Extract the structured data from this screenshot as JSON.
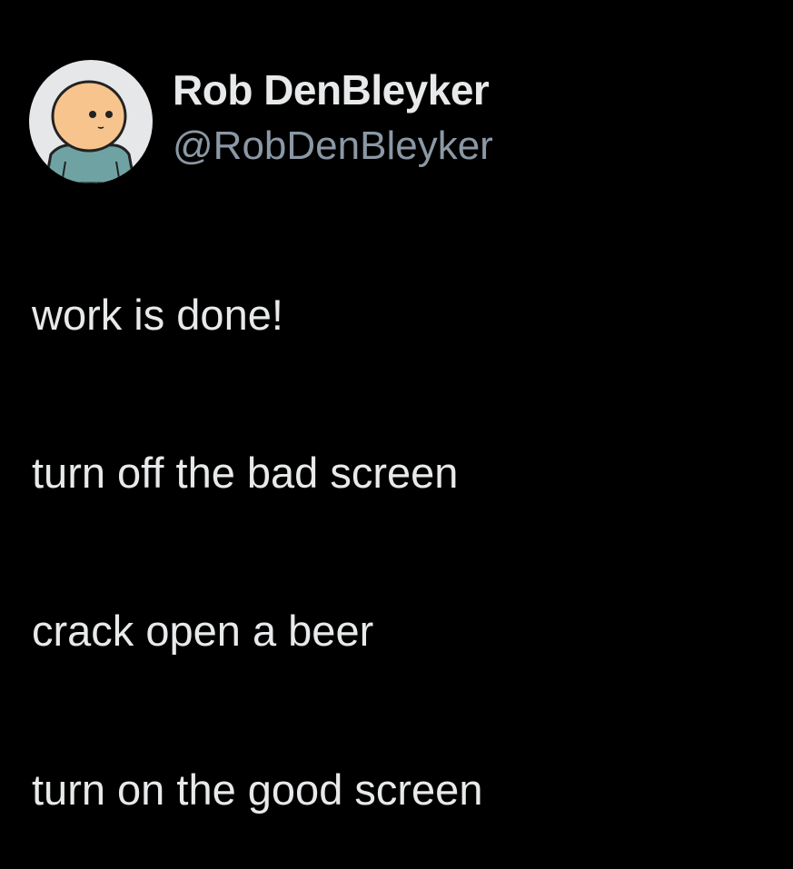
{
  "author": {
    "display_name": "Rob DenBleyker",
    "handle": "@RobDenBleyker",
    "avatar_icon": "cartoon-character-avatar-icon"
  },
  "tweet": {
    "lines": [
      "work is done!",
      "turn off the bad screen",
      "crack open a beer",
      "turn on the good screen"
    ]
  },
  "colors": {
    "background": "#000000",
    "primary_text": "#e7e9ea",
    "secondary_text": "#8b98a5",
    "avatar_bg": "#e6e7e8",
    "avatar_skin": "#f6c48c",
    "avatar_shirt": "#6fa3a3"
  }
}
